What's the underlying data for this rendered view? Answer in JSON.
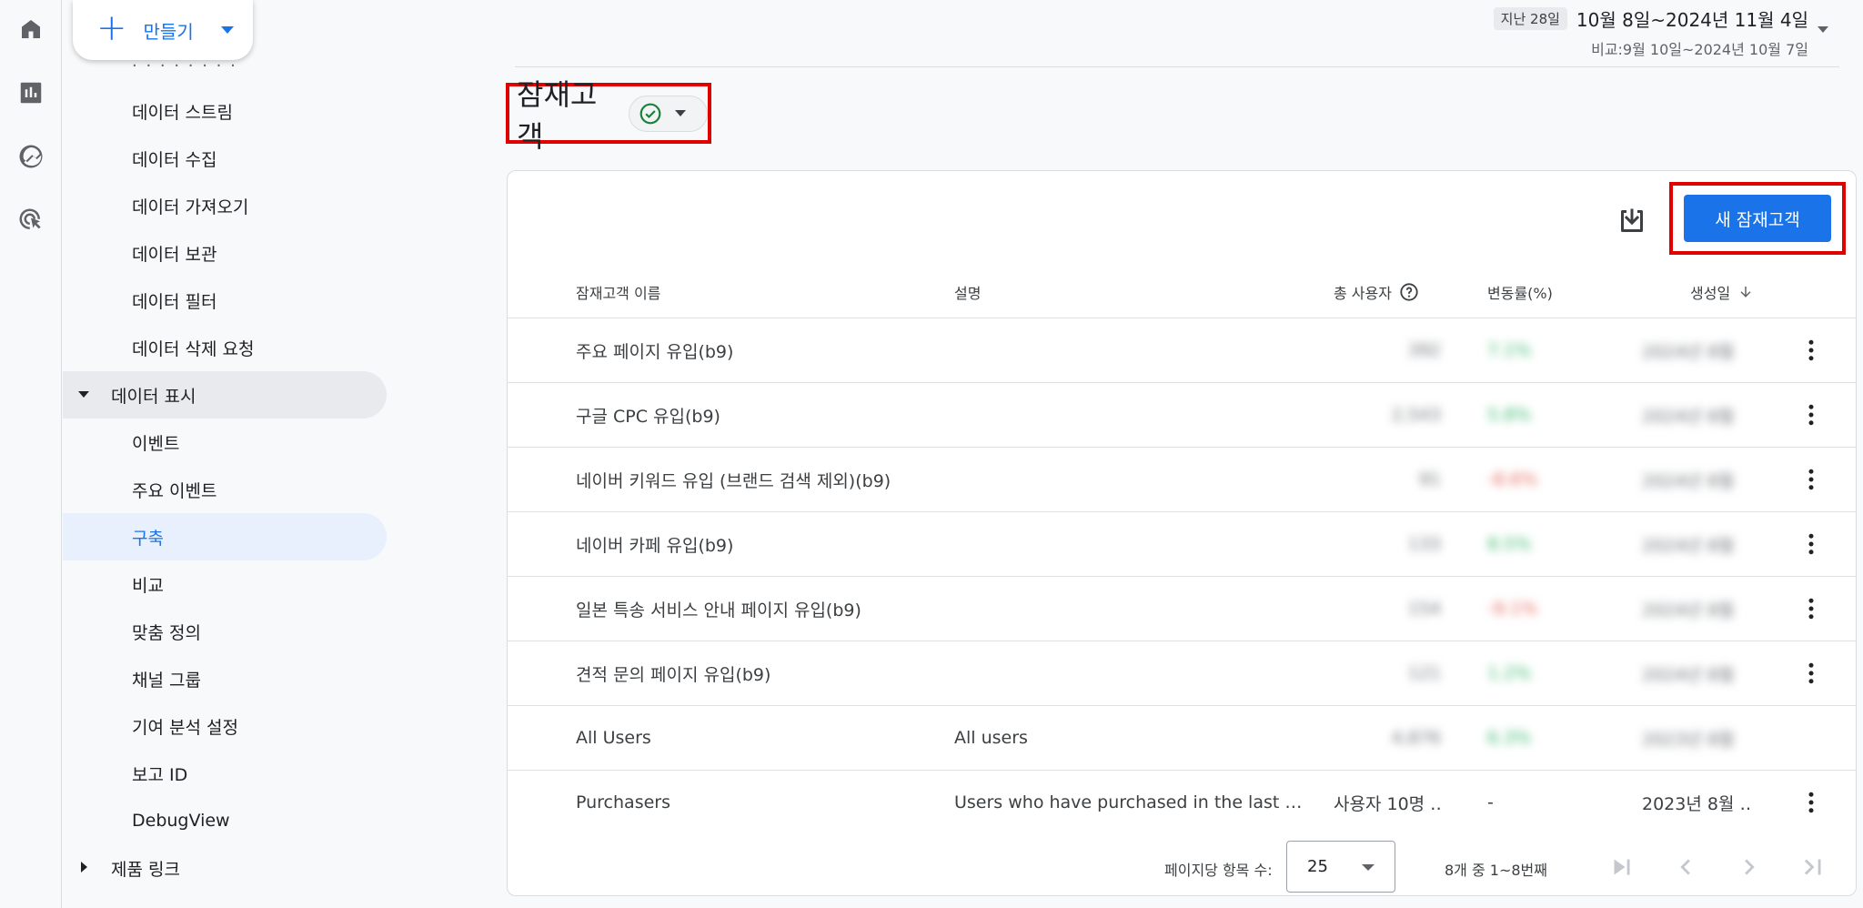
{
  "create": {
    "label": "만들기"
  },
  "rail": {
    "icons": [
      "home-icon",
      "reports-icon",
      "explore-icon",
      "advertising-icon"
    ]
  },
  "sidebar": {
    "items": [
      {
        "label": "데이터 스트림"
      },
      {
        "label": "데이터 수집"
      },
      {
        "label": "데이터 가져오기"
      },
      {
        "label": "데이터 보관"
      },
      {
        "label": "데이터 필터"
      },
      {
        "label": "데이터 삭제 요청"
      },
      {
        "label": "데이터 표시"
      },
      {
        "label": "이벤트"
      },
      {
        "label": "주요 이벤트"
      },
      {
        "label": "구축"
      },
      {
        "label": "비교"
      },
      {
        "label": "맞춤 정의"
      },
      {
        "label": "채널 그룹"
      },
      {
        "label": "기여 분석 설정"
      },
      {
        "label": "보고 ID"
      },
      {
        "label": "DebugView"
      },
      {
        "label": "제품 링크"
      }
    ]
  },
  "date_range": {
    "badge": "지난 28일",
    "range": "10월 8일~2024년 11월 4일",
    "compare": "비교:9월 10일~2024년 10월 7일"
  },
  "page": {
    "title": "잠재고객"
  },
  "toolbar": {
    "new_label": "새 잠재고객"
  },
  "table": {
    "headers": {
      "name": "잠재고객 이름",
      "desc": "설명",
      "users": "총 사용자",
      "change": "변동률(%)",
      "created": "생성일"
    },
    "rows": [
      {
        "name": "주요 페이지 유입(b9)",
        "desc": "",
        "users": "392",
        "change": "7.1%",
        "created": "2024년 8월",
        "change_color": "green"
      },
      {
        "name": "구글 CPC 유입(b9)",
        "desc": "",
        "users": "2,543",
        "change": "5.8%",
        "created": "2024년 8월",
        "change_color": "green"
      },
      {
        "name": "네이버 키워드 유입 (브랜드 검색 제외)(b9)",
        "desc": "",
        "users": "91",
        "change": "-8.6%",
        "created": "2024년 8월",
        "change_color": "red"
      },
      {
        "name": "네이버 카페 유입(b9)",
        "desc": "",
        "users": "133",
        "change": "8.5%",
        "created": "2024년 8월",
        "change_color": "green"
      },
      {
        "name": "일본 특송 서비스 안내 페이지 유입(b9)",
        "desc": "",
        "users": "154",
        "change": "-9.1%",
        "created": "2024년 8월",
        "change_color": "red"
      },
      {
        "name": "견적 문의 페이지 유입(b9)",
        "desc": "",
        "users": "121",
        "change": "1.2%",
        "created": "2024년 8월",
        "change_color": "green"
      },
      {
        "name": "All Users",
        "desc": "All users",
        "users": "4,876",
        "change": "6.3%",
        "created": "2023년 8월",
        "change_color": "green"
      },
      {
        "name": "Purchasers",
        "desc": "Users who have purchased in the last …",
        "users": "사용자 10명 …",
        "change": "-",
        "created": "2023년 8월 …",
        "change_color": "plain"
      }
    ]
  },
  "pagination": {
    "per_page_label": "페이지당 항목 수:",
    "per_page_value": "25",
    "range": "8개 중 1~8번째"
  },
  "colors": {
    "accent": "#1a73e8",
    "highlight": "#e00000"
  }
}
